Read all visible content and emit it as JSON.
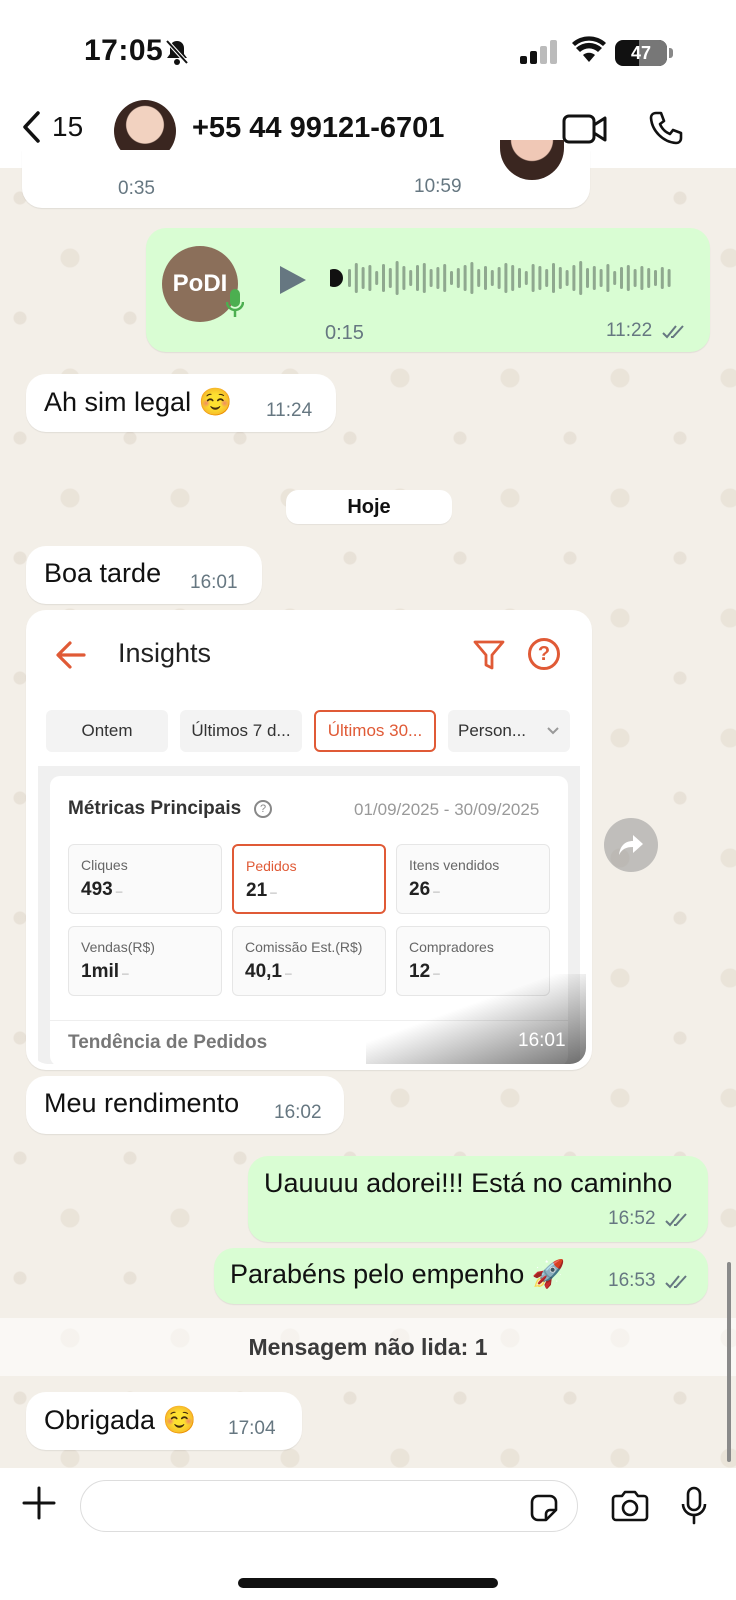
{
  "status": {
    "time": "17:05",
    "battery": "47",
    "battery_level": 0.47
  },
  "header": {
    "back_count": "15",
    "contact": "+55 44 99121-6701"
  },
  "messages": {
    "top": {
      "duration": "0:35",
      "time": "10:59"
    },
    "voice": {
      "avatar_text": "PoDI",
      "duration": "0:15",
      "time": "11:22"
    },
    "ahsim": {
      "text": "Ah sim legal ☺️",
      "time": "11:24"
    },
    "date_chip": "Hoje",
    "boatarde": {
      "text": "Boa tarde",
      "time": "16:01"
    },
    "image": {
      "time": "16:01",
      "screen_title": "Insights",
      "chips": [
        "Ontem",
        "Últimos 7 d...",
        "Últimos 30...",
        "Person..."
      ],
      "metrics_title": "Métricas Principais",
      "date_range": "01/09/2025 - 30/09/2025",
      "metrics": [
        {
          "label": "Cliques",
          "value": "493"
        },
        {
          "label": "Pedidos",
          "value": "21"
        },
        {
          "label": "Itens vendidos",
          "value": "26"
        },
        {
          "label": "Vendas(R$)",
          "value": "1mil"
        },
        {
          "label": "Comissão Est.(R$)",
          "value": "40,1"
        },
        {
          "label": "Compradores",
          "value": "12"
        }
      ],
      "dash": "–",
      "trend_title": "Tendência de Pedidos"
    },
    "rendimento": {
      "text": "Meu rendimento",
      "time": "16:02"
    },
    "uau": {
      "text": "Uauuuu adorei!!! Está no caminho",
      "time": "16:52"
    },
    "parabens": {
      "text": "Parabéns pelo empenho 🚀",
      "time": "16:53"
    },
    "unread": "Mensagem não lida: 1",
    "obrigada": {
      "text": "Obrigada ☺️",
      "time": "17:04"
    }
  },
  "composer": {
    "placeholder": ""
  },
  "colors": {
    "accent": "#e05a36",
    "outgoing": "#d9fdd3",
    "incoming": "#ffffff",
    "meta": "#667781"
  }
}
